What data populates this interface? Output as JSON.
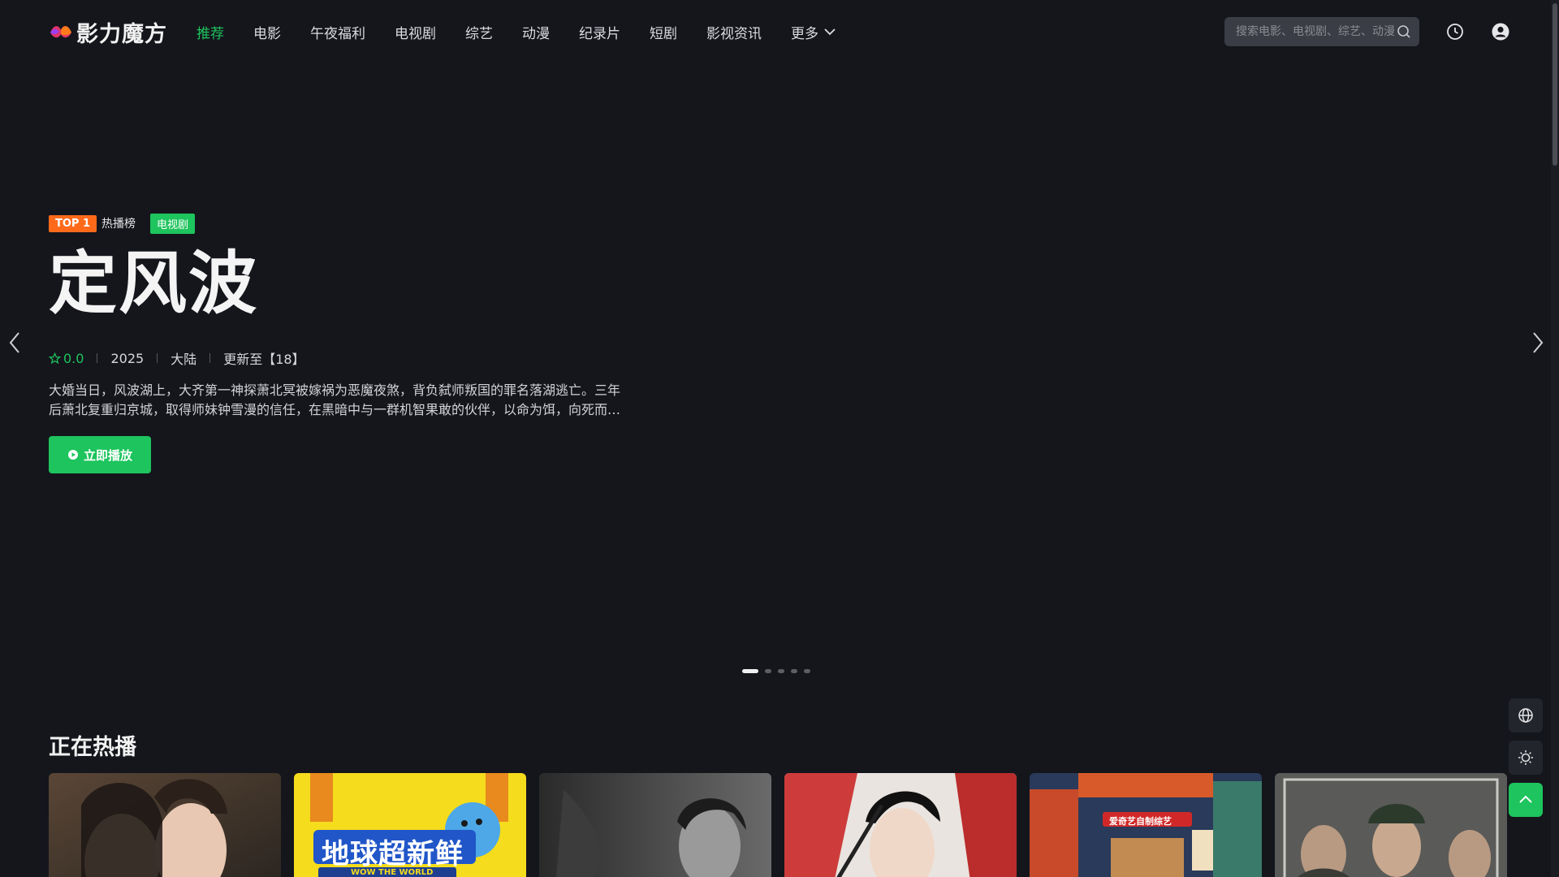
{
  "header": {
    "logo_text": "影力魔方",
    "nav": [
      {
        "label": "推荐",
        "active": true
      },
      {
        "label": "电影"
      },
      {
        "label": "午夜福利"
      },
      {
        "label": "电视剧"
      },
      {
        "label": "综艺"
      },
      {
        "label": "动漫"
      },
      {
        "label": "纪录片"
      },
      {
        "label": "短剧"
      },
      {
        "label": "影视资讯"
      }
    ],
    "more_label": "更多",
    "search_placeholder": "搜索电影、电视剧、综艺、动漫",
    "icons": [
      "search-icon",
      "history-icon",
      "user-icon"
    ]
  },
  "hero": {
    "badge_top": "TOP 1",
    "badge_hot": "热播榜",
    "badge_genre": "电视剧",
    "title": "定风波",
    "rating": "0.0",
    "year": "2025",
    "region": "大陆",
    "update": "更新至【18】",
    "description": "大婚当日，风波湖上，大齐第一神探萧北冥被嫁祸为恶魔夜煞，背负弑师叛国的罪名落湖逃亡。三年后萧北复重归京城，取得师妹钟雪漫的信任，在黑暗中与一群机智果敢的伙伴，以命为饵，向死而生，揭开真相。",
    "play_label": "立即播放",
    "slides": 5,
    "active_slide": 0
  },
  "section": {
    "title": "正在热播"
  },
  "cards": [
    {
      "name": "poster-1"
    },
    {
      "name": "poster-2",
      "text": "地球超新鲜",
      "subtext": "WOW THE WORLD"
    },
    {
      "name": "poster-3"
    },
    {
      "name": "poster-4"
    },
    {
      "name": "poster-5",
      "text": "爱奇艺自制综艺"
    },
    {
      "name": "poster-6"
    }
  ],
  "colors": {
    "accent": "#1ec45d",
    "top_badge": "#ff6a1a",
    "background": "#14161c"
  }
}
